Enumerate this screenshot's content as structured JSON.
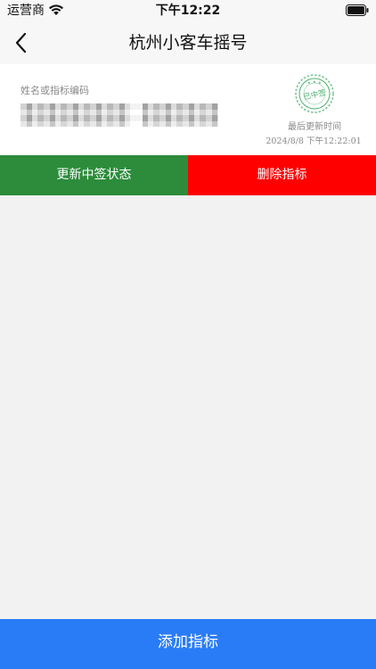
{
  "status_bar": {
    "carrier": "运营商",
    "time": "下午12:22",
    "wifi_icon": "wifi-icon",
    "battery_icon": "battery-icon"
  },
  "nav": {
    "back_icon": "chevron-left-icon",
    "title": "杭州小客车摇号"
  },
  "card": {
    "field_label": "姓名或指标编码",
    "value_redacted": true,
    "stamp_text": "已中签",
    "stamp_color": "#4caf6e",
    "last_updated_label": "最后更新时间",
    "last_updated_time": "2024/8/8 下午12:22:01"
  },
  "actions": {
    "update_label": "更新中签状态",
    "update_color": "#2c8c3b",
    "delete_label": "删除指标",
    "delete_color": "#ff0000"
  },
  "footer": {
    "add_label": "添加指标",
    "add_color": "#2a7cf6"
  }
}
